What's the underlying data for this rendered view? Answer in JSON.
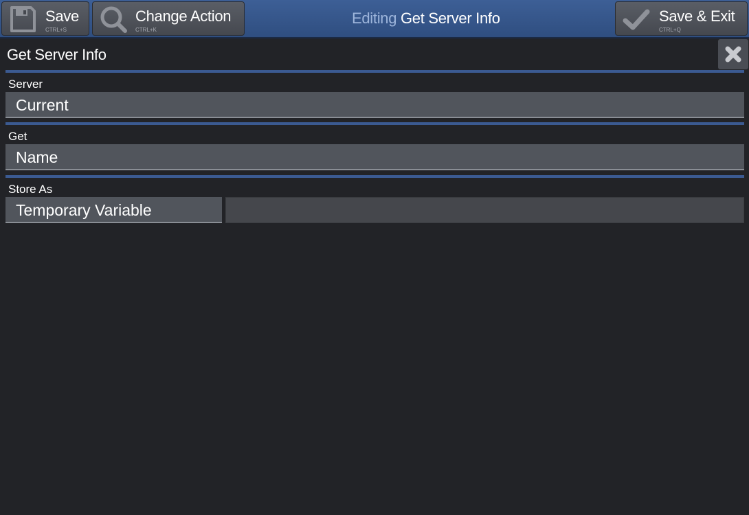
{
  "toolbar": {
    "save": {
      "label": "Save",
      "shortcut": "CTRL+S",
      "icon": "floppy-disk-icon"
    },
    "change_action": {
      "label": "Change Action",
      "shortcut": "CTRL+K",
      "icon": "magnifier-icon"
    },
    "save_exit": {
      "label": "Save & Exit",
      "shortcut": "CTRL+Q",
      "icon": "checkmark-icon"
    },
    "editing_prefix": "Editing",
    "editing_name": "Get Server Info"
  },
  "panel": {
    "title": "Get Server Info",
    "close_icon": "close-x-icon"
  },
  "fields": {
    "server": {
      "label": "Server",
      "value": "Current"
    },
    "get": {
      "label": "Get",
      "value": "Name"
    },
    "store_as": {
      "label": "Store As",
      "value": "Temporary Variable",
      "variable_name": ""
    }
  },
  "colors": {
    "toolbar": "#2f4e80",
    "accent_divider": "#3b5a91",
    "background": "#222327",
    "field": "#51555c"
  }
}
